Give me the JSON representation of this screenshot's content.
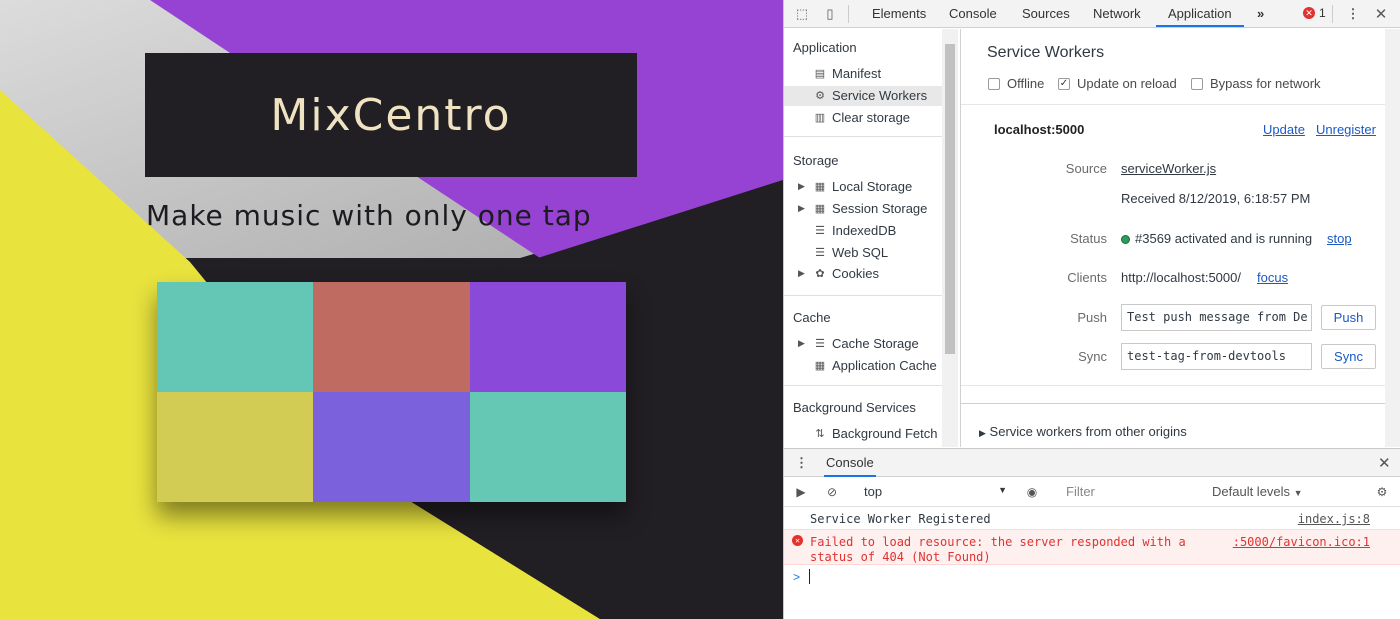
{
  "webpage": {
    "logo": "MixCentro",
    "tagline": "Make music with only one tap",
    "pads": [
      {
        "name": "pad-teal",
        "color": "#64c7b5"
      },
      {
        "name": "pad-salmon",
        "color": "#c06b62"
      },
      {
        "name": "pad-purple",
        "color": "#8a49d8"
      },
      {
        "name": "pad-yellow",
        "color": "#d2cb54"
      },
      {
        "name": "pad-violet",
        "color": "#7b62dc"
      },
      {
        "name": "pad-teal-2",
        "color": "#64c8b5"
      }
    ],
    "colors": {
      "purple": "#9642d2",
      "yellow": "#e9e33e",
      "dark": "#221f24",
      "silver": "#c8c8c8"
    }
  },
  "devtools": {
    "tabs": [
      "Elements",
      "Console",
      "Sources",
      "Network",
      "Application"
    ],
    "active_tab": "Application",
    "more_tabs_icon": "»",
    "error_count": "1",
    "sidebar": {
      "application_header": "Application",
      "application_items": [
        "Manifest",
        "Service Workers",
        "Clear storage"
      ],
      "storage_header": "Storage",
      "storage_items": [
        "Local Storage",
        "Session Storage",
        "IndexedDB",
        "Web SQL",
        "Cookies"
      ],
      "cache_header": "Cache",
      "cache_items": [
        "Cache Storage",
        "Application Cache"
      ],
      "background_header": "Background Services",
      "background_items": [
        "Background Fetch"
      ]
    },
    "service_workers": {
      "title": "Service Workers",
      "options": {
        "offline": "Offline",
        "update_on_reload": "Update on reload",
        "bypass": "Bypass for network"
      },
      "host": "localhost:5000",
      "update_link": "Update",
      "unregister_link": "Unregister",
      "source_label": "Source",
      "source_file": "serviceWorker.js",
      "received": "Received 8/12/2019, 6:18:57 PM",
      "status_label": "Status",
      "status_text": "#3569 activated and is running",
      "stop_link": "stop",
      "clients_label": "Clients",
      "clients_value": "http://localhost:5000/",
      "focus_link": "focus",
      "push_label": "Push",
      "push_value": "Test push message from De",
      "push_button": "Push",
      "sync_label": "Sync",
      "sync_value": "test-tag-from-devtools",
      "sync_button": "Sync",
      "other_origins": "Service workers from other origins"
    },
    "drawer": {
      "tab": "Console",
      "context": "top",
      "filter_placeholder": "Filter",
      "levels": "Default levels",
      "messages": [
        {
          "text": "Service Worker Registered",
          "source": "index.js:8",
          "type": "log"
        },
        {
          "text": "Failed to load resource: the server responded with a",
          "text2": "status of 404 (Not Found)",
          "source": ":5000/favicon.ico:1",
          "type": "error"
        }
      ],
      "prompt": ">"
    }
  }
}
